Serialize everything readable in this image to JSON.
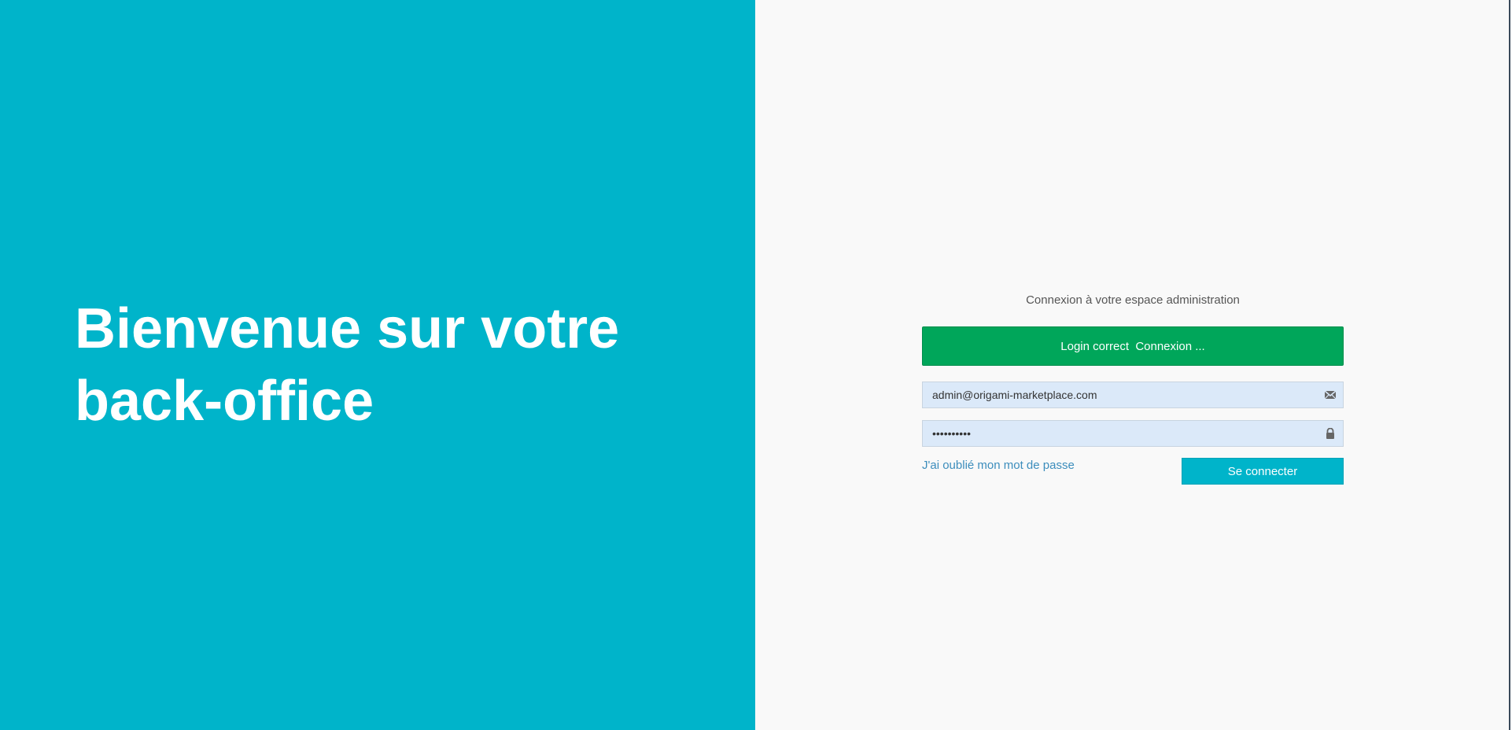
{
  "hero": {
    "title": "Bienvenue sur votre back-office"
  },
  "login": {
    "subtitle": "Connexion à votre espace administration",
    "alert_text": "Login correct  Connexion ...",
    "email": {
      "value": "admin@origami-marketplace.com",
      "icon": "envelope-icon"
    },
    "password": {
      "value": "••••••••••",
      "icon": "lock-icon"
    },
    "forgot_label": "J'ai oublié mon mot de passe",
    "submit_label": "Se connecter"
  },
  "colors": {
    "brand": "#00b4ca",
    "success": "#00a65a",
    "link": "#3c8dbc",
    "input_bg": "#dbe9f9",
    "panel_bg": "#f9f9f9"
  }
}
